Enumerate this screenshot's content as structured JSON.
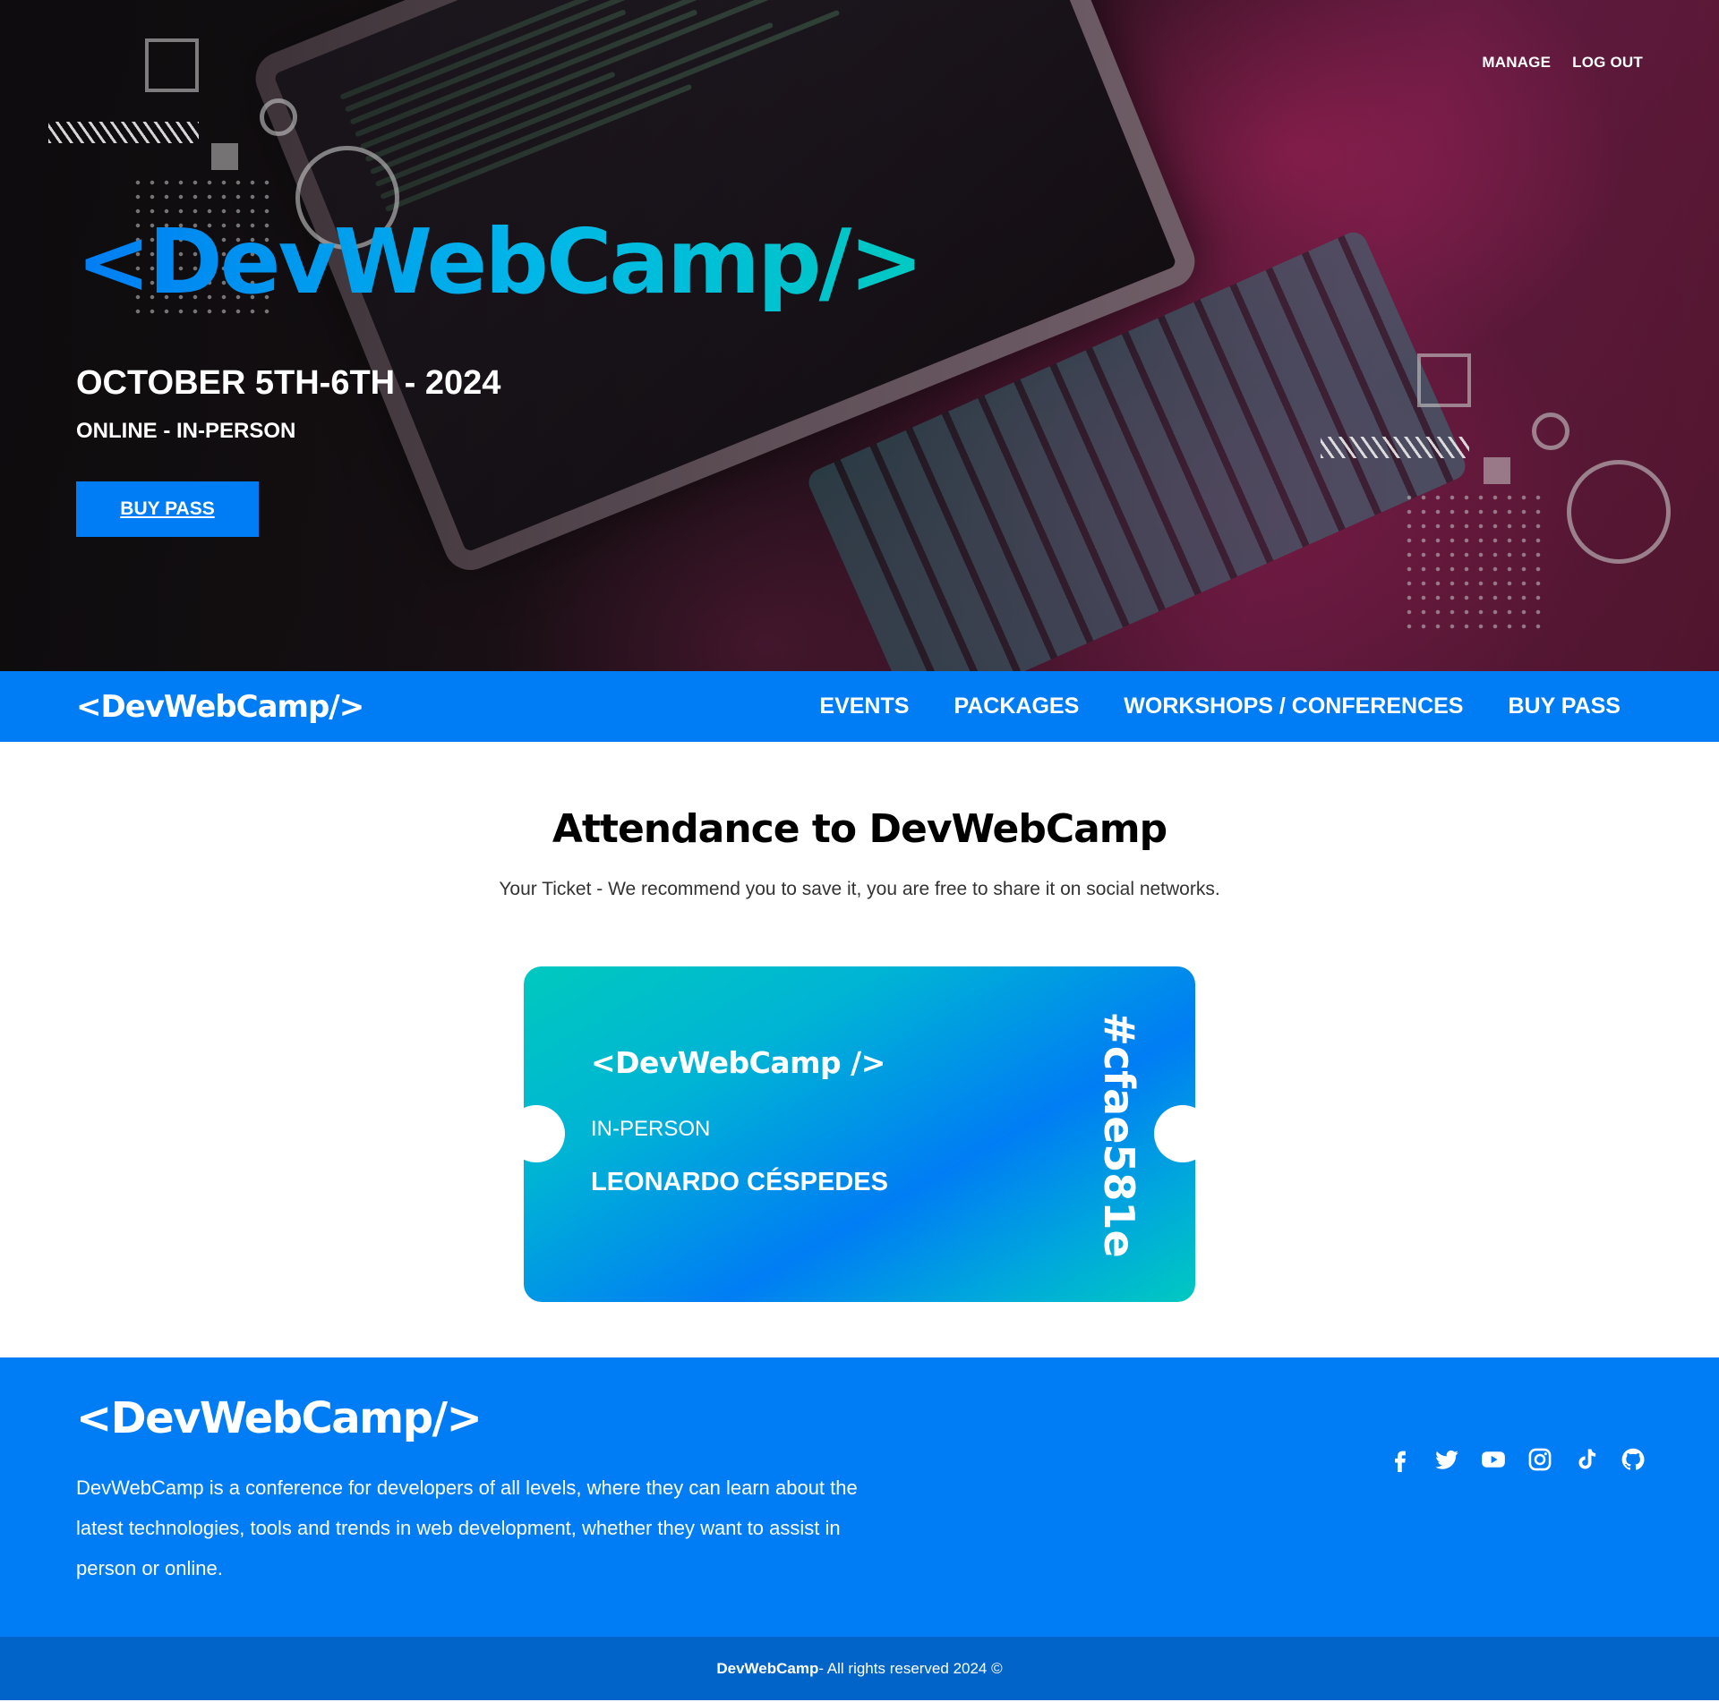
{
  "hero": {
    "top_nav": {
      "manage": "MANAGE",
      "logout": "LOG OUT"
    },
    "logo": "<DevWebCamp/>",
    "date": "OCTOBER 5TH-6TH - 2024",
    "mode": "ONLINE - IN-PERSON",
    "buy_button": "BUY PASS"
  },
  "navbar": {
    "brand": "<DevWebCamp/>",
    "links": [
      "EVENTS",
      "PACKAGES",
      "WORKSHOPS / CONFERENCES",
      "BUY PASS"
    ]
  },
  "main": {
    "title": "Attendance to DevWebCamp",
    "subtitle": "Your Ticket - We recommend you to save it, you are free to share it on social networks.",
    "ticket": {
      "brand": "<DevWebCamp />",
      "mode": "IN-PERSON",
      "name": "LEONARDO CÉSPEDES",
      "code": "#cfae581e"
    }
  },
  "footer": {
    "brand": "<DevWebCamp/>",
    "description": "DevWebCamp is a conference for developers of all levels, where they can learn about the latest technologies, tools and trends in web development, whether they want to assist in person or online.",
    "social_icons": [
      "facebook-icon",
      "twitter-icon",
      "youtube-icon",
      "instagram-icon",
      "tiktok-icon",
      "github-icon"
    ],
    "copyright_brand": "DevWebCamp",
    "copyright_text": " - All rights reserved 2024 ©"
  },
  "colors": {
    "primary": "#007df4",
    "primary_dark": "#0064c9",
    "accent_teal": "#00c9c1"
  }
}
